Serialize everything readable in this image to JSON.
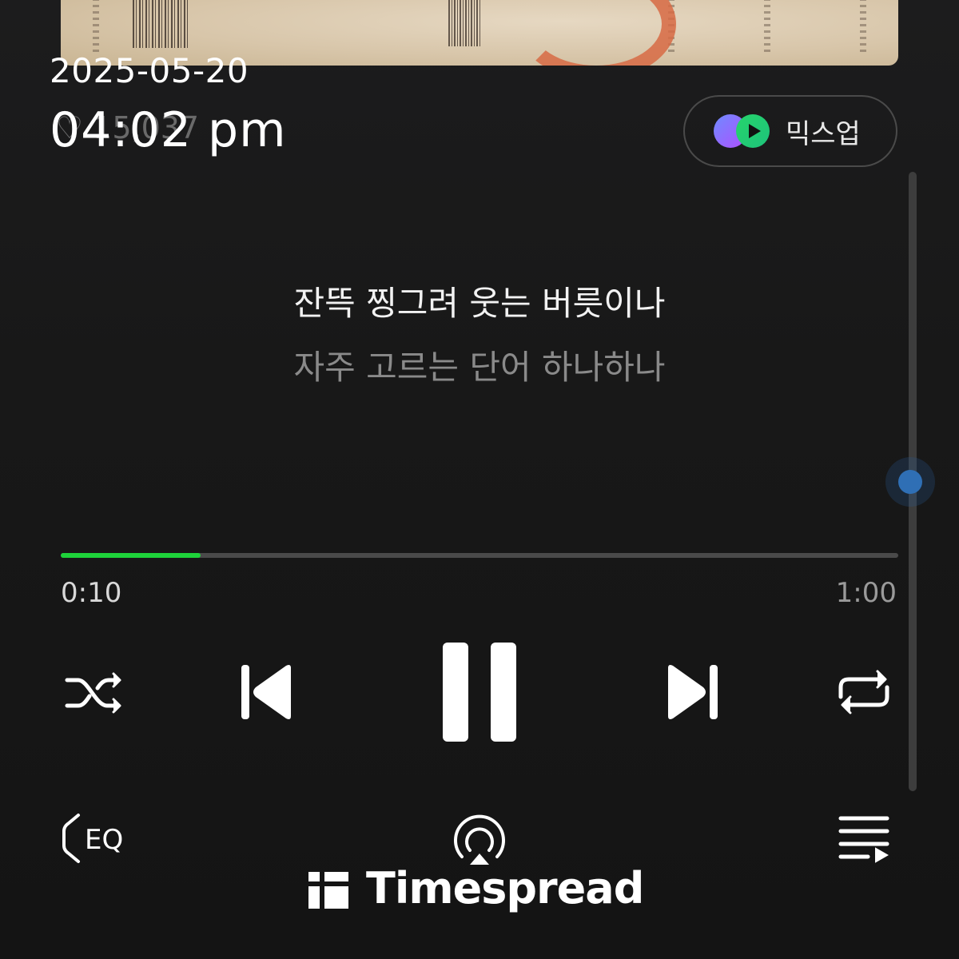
{
  "overlay": {
    "date": "2025-05-20",
    "time": "04:02 pm"
  },
  "player": {
    "likes_partial": "♡ 15,037",
    "mixup_label": "믹스업",
    "lyrics": {
      "current": "잔뜩 찡그려 웃는 버릇이나",
      "next": "자주 고르는 단어 하나하나"
    },
    "progress": {
      "current_time": "0:10",
      "total_time": "1:00",
      "fraction": 0.1667
    },
    "accent_color": "#1ed33a",
    "controls": {
      "shuffle": "shuffle-icon",
      "previous": "skip-previous-icon",
      "pause": "pause-icon",
      "next": "skip-next-icon",
      "repeat": "repeat-icon",
      "eq_label": "EQ",
      "cast": "airplay-icon",
      "queue": "playlist-icon"
    }
  },
  "watermark": {
    "text": "Timespread"
  }
}
